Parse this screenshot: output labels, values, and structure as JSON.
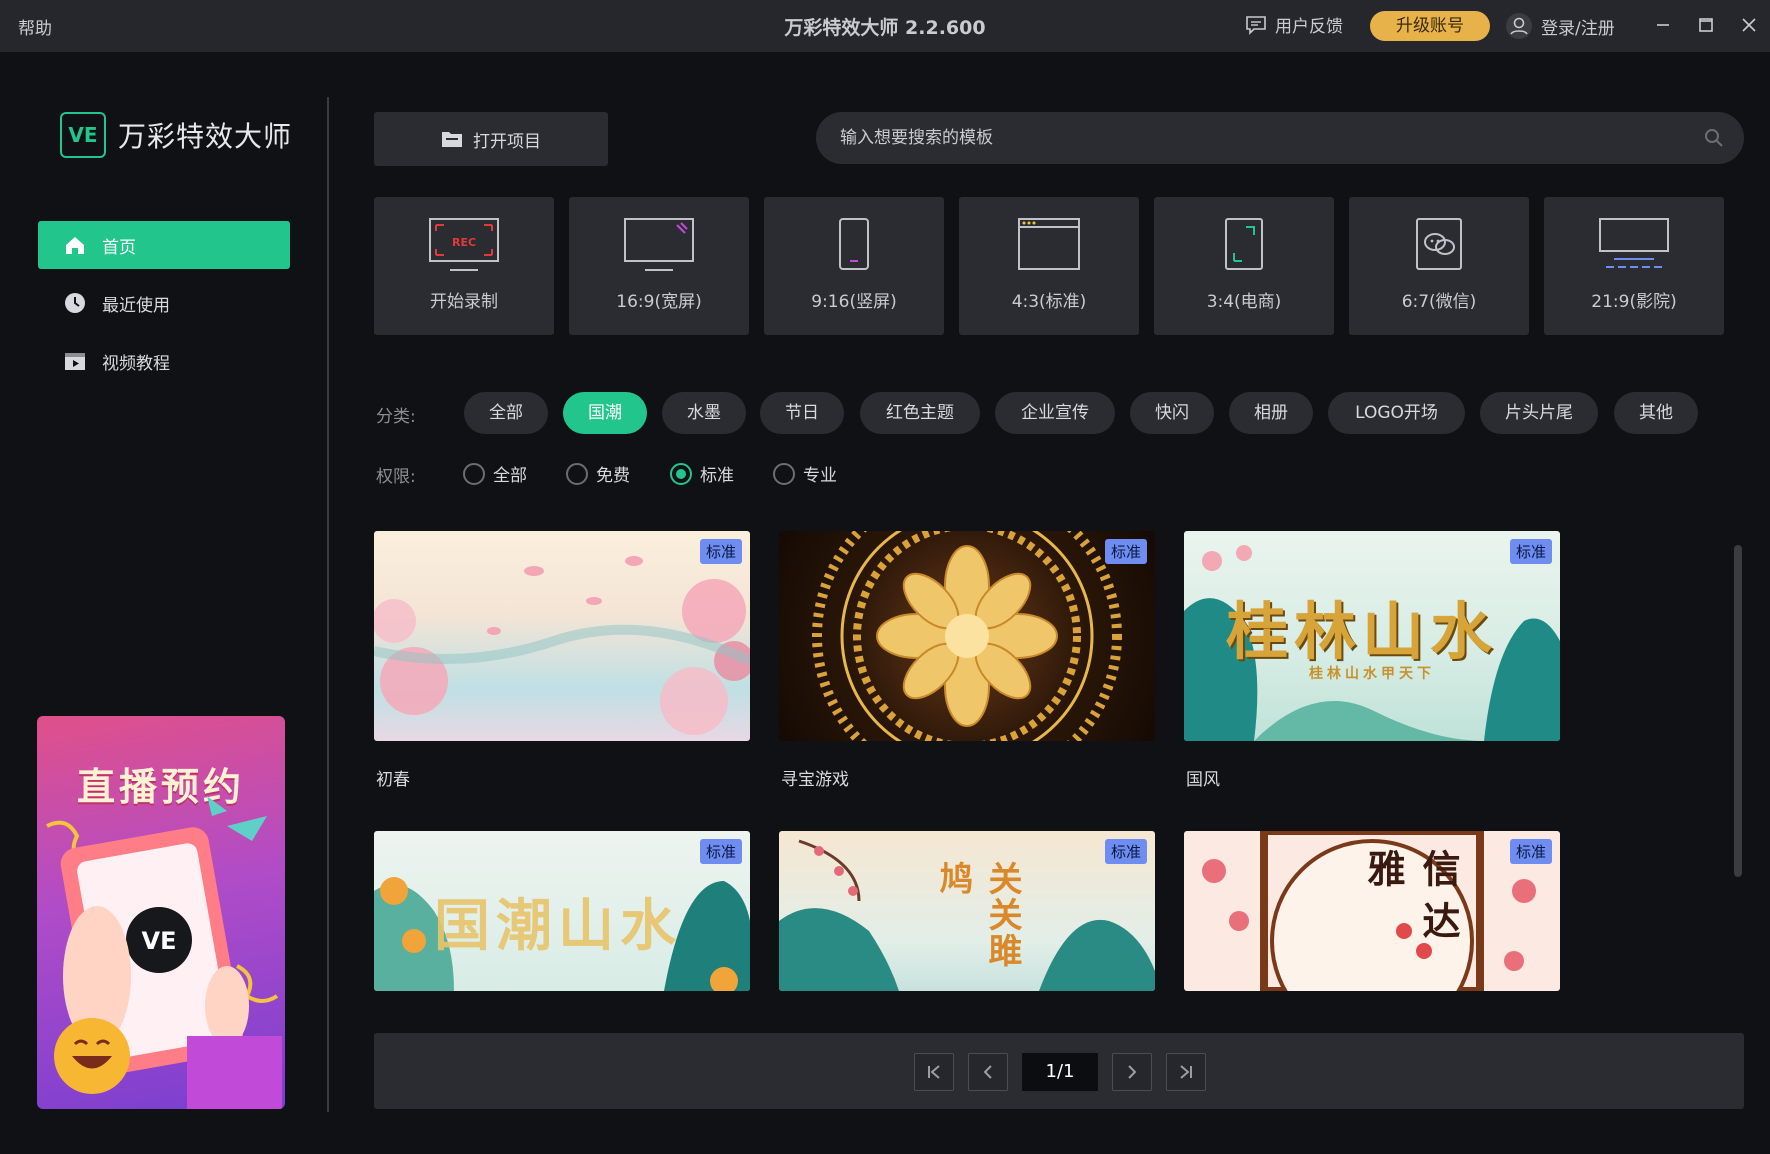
{
  "titlebar": {
    "help": "帮助",
    "title": "万彩特效大师 2.2.600",
    "feedback": "用户反馈",
    "upgrade": "升级账号",
    "login": "登录/注册"
  },
  "sidebar": {
    "logo_mark": "VE",
    "logo_text": "万彩特效大师",
    "items": [
      {
        "label": "首页",
        "icon": "home-icon",
        "active": true
      },
      {
        "label": "最近使用",
        "icon": "clock-icon",
        "active": false
      },
      {
        "label": "视频教程",
        "icon": "video-tutorial-icon",
        "active": false
      }
    ],
    "banner": {
      "title": "直播预约",
      "mark": "VE"
    }
  },
  "toolbar": {
    "open_project": "打开项目",
    "search_placeholder": "输入想要搜索的模板"
  },
  "ratios": [
    {
      "label": "开始录制",
      "icon": "record-icon",
      "rec": "REC"
    },
    {
      "label": "16:9(宽屏)",
      "icon": "widescreen-icon"
    },
    {
      "label": "9:16(竖屏)",
      "icon": "portrait-icon"
    },
    {
      "label": "4:3(标准)",
      "icon": "standard-icon"
    },
    {
      "label": "3:4(电商)",
      "icon": "ecommerce-icon"
    },
    {
      "label": "6:7(微信)",
      "icon": "wechat-icon"
    },
    {
      "label": "21:9(影院)",
      "icon": "cinema-icon"
    }
  ],
  "filters": {
    "category_label": "分类:",
    "categories": [
      "全部",
      "国潮",
      "水墨",
      "节日",
      "红色主题",
      "企业宣传",
      "快闪",
      "相册",
      "LOGO开场",
      "片头片尾",
      "其他"
    ],
    "active_category": "国潮",
    "permission_label": "权限:",
    "permissions": [
      "全部",
      "免费",
      "标准",
      "专业"
    ],
    "active_permission": "标准"
  },
  "templates": [
    {
      "title": "初春",
      "badge": "标准"
    },
    {
      "title": "寻宝游戏",
      "badge": "标准"
    },
    {
      "title": "国风",
      "badge": "标准",
      "art_text": "桂林山水",
      "art_sub": "桂林山水甲天下"
    },
    {
      "title": "",
      "badge": "标准",
      "art_text": "国潮山水"
    },
    {
      "title": "",
      "badge": "标准",
      "art_text": "关关雎鸠"
    },
    {
      "title": "",
      "badge": "标准",
      "art_text": "信达雅"
    }
  ],
  "pager": {
    "page": "1/1"
  },
  "colors": {
    "accent": "#22c58b",
    "upgrade": "#e8b24a",
    "badge": "#6f8cf0"
  }
}
